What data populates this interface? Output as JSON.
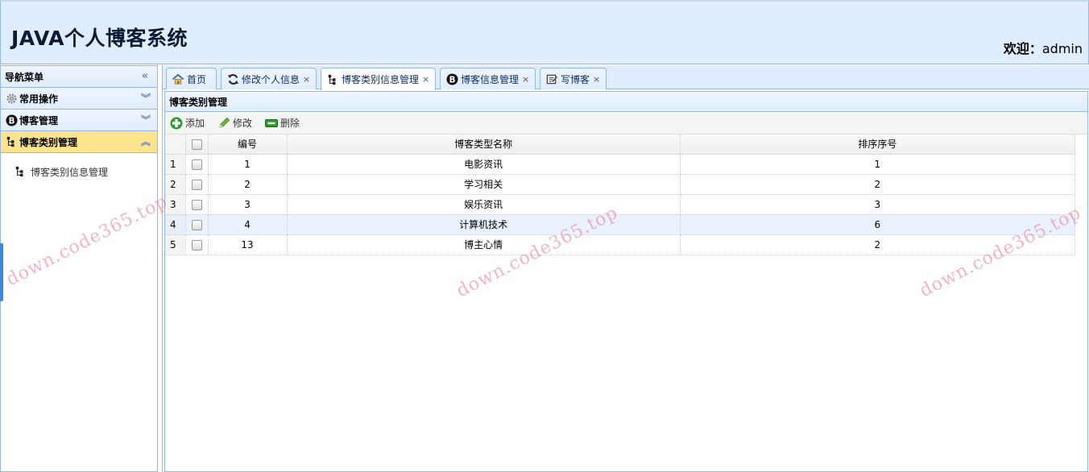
{
  "header": {
    "title": "JAVA个人博客系统",
    "welcome_label": "欢迎：",
    "username": "admin"
  },
  "nav": {
    "title": "导航菜单",
    "sections": [
      {
        "label": "常用操作",
        "icon": "gear-icon"
      },
      {
        "label": "博客管理",
        "icon": "blog-logo-icon"
      },
      {
        "label": "博客类别管理",
        "icon": "tree-icon"
      }
    ],
    "tree_items": [
      {
        "label": "博客类别信息管理",
        "icon": "tree-icon"
      }
    ]
  },
  "tabs": [
    {
      "label": "首页",
      "icon": "home-icon",
      "closable": false
    },
    {
      "label": "修改个人信息",
      "icon": "refresh-icon",
      "closable": true
    },
    {
      "label": "博客类别信息管理",
      "icon": "tree-icon",
      "closable": true,
      "active": true
    },
    {
      "label": "博客信息管理",
      "icon": "blog-logo-icon",
      "closable": true
    },
    {
      "label": "写博客",
      "icon": "edit-note-icon",
      "closable": true
    }
  ],
  "tab_close_glyph": "×",
  "content": {
    "title": "博客类别管理",
    "toolbar": {
      "add_label": "添加",
      "edit_label": "修改",
      "delete_label": "删除"
    },
    "table": {
      "columns": [
        "编号",
        "博客类型名称",
        "排序序号"
      ],
      "rows": [
        {
          "rownum": "1",
          "id": "1",
          "name": "电影资讯",
          "order": "1"
        },
        {
          "rownum": "2",
          "id": "2",
          "name": "学习相关",
          "order": "2"
        },
        {
          "rownum": "3",
          "id": "3",
          "name": "娱乐资讯",
          "order": "3"
        },
        {
          "rownum": "4",
          "id": "4",
          "name": "计算机技术",
          "order": "6"
        },
        {
          "rownum": "5",
          "id": "13",
          "name": "博主心情",
          "order": "2"
        }
      ],
      "highlighted_row": 4
    }
  },
  "watermark": "down.code365.top",
  "colors": {
    "header_bg": "#e0ecff",
    "border": "#95b8e7",
    "selected_section": "#ffe48d",
    "watermark": "#e6789a"
  }
}
